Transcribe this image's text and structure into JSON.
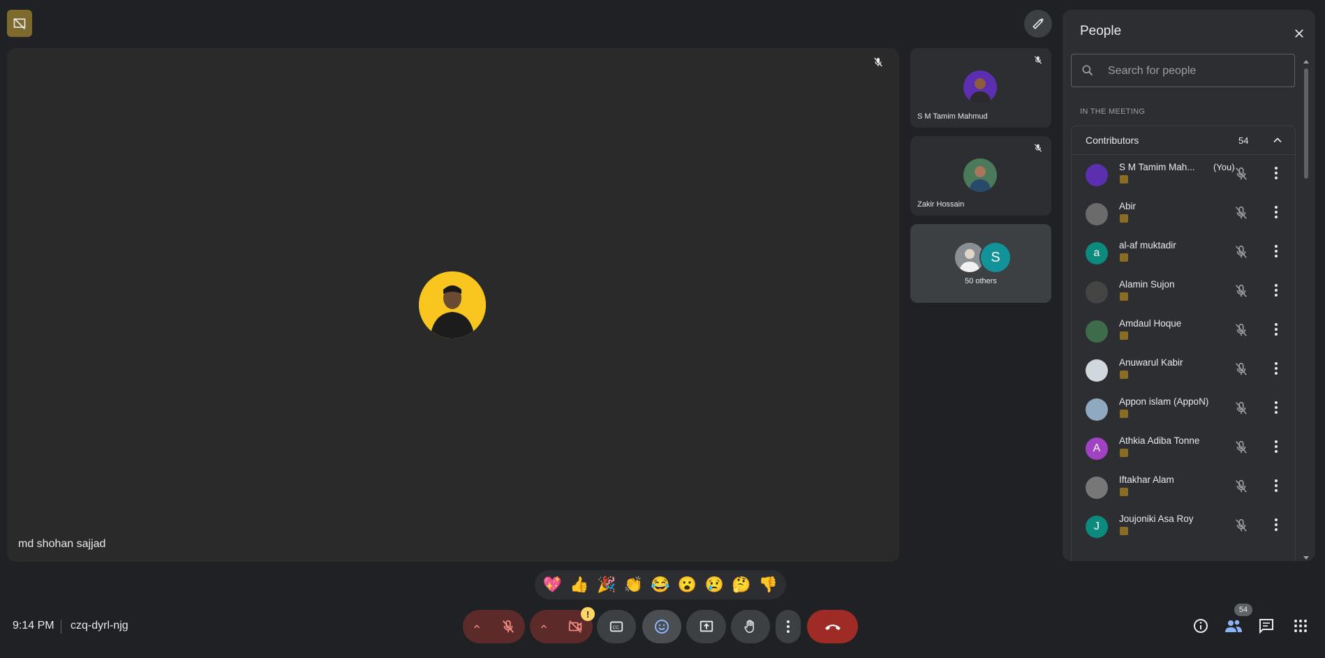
{
  "stage": {
    "speaker_name": "md shohan sajjad"
  },
  "tiles": [
    {
      "name": "S M Tamim Mahmud"
    },
    {
      "name": "Zakir Hossain"
    }
  ],
  "others": {
    "label": "50 others",
    "initial": "S"
  },
  "panel": {
    "title": "People",
    "search_placeholder": "Search for people",
    "section_label": "IN THE MEETING",
    "group_title": "Contributors",
    "group_count": "54",
    "participants": [
      {
        "name": "S M Tamim Mah...",
        "you": "(You)",
        "initial": "",
        "color": "#5b2fb0"
      },
      {
        "name": "Abir",
        "you": "",
        "initial": "",
        "color": "#6b6b6b"
      },
      {
        "name": "al-af muktadir",
        "you": "",
        "initial": "a",
        "color": "#0b8a7d"
      },
      {
        "name": "Alamin Sujon",
        "you": "",
        "initial": "",
        "color": "#444"
      },
      {
        "name": "Amdaul Hoque",
        "you": "",
        "initial": "",
        "color": "#3e6b4a"
      },
      {
        "name": "Anuwarul Kabir",
        "you": "",
        "initial": "",
        "color": "#cfd8dc"
      },
      {
        "name": "Appon islam (AppoN)",
        "you": "",
        "initial": "",
        "color": "#8fa9c0"
      },
      {
        "name": "Athkia Adiba Tonne",
        "you": "",
        "initial": "A",
        "color": "#a142c4"
      },
      {
        "name": "Iftakhar Alam",
        "you": "",
        "initial": "",
        "color": "#777"
      },
      {
        "name": "Joujoniki Asa Roy",
        "you": "",
        "initial": "J",
        "color": "#0b8a7d"
      }
    ]
  },
  "reactions": [
    "💖",
    "👍",
    "🎉",
    "👏",
    "😂",
    "😮",
    "😢",
    "🤔",
    "👎"
  ],
  "bottom": {
    "time": "9:14 PM",
    "meeting_code": "czq-dyrl-njg",
    "people_count": "54",
    "warning": "!"
  },
  "colors": {
    "background": "#202124",
    "end_call": "#9e2b25",
    "muted_red": "#5c2b29",
    "badge": "#7d6a2c"
  }
}
